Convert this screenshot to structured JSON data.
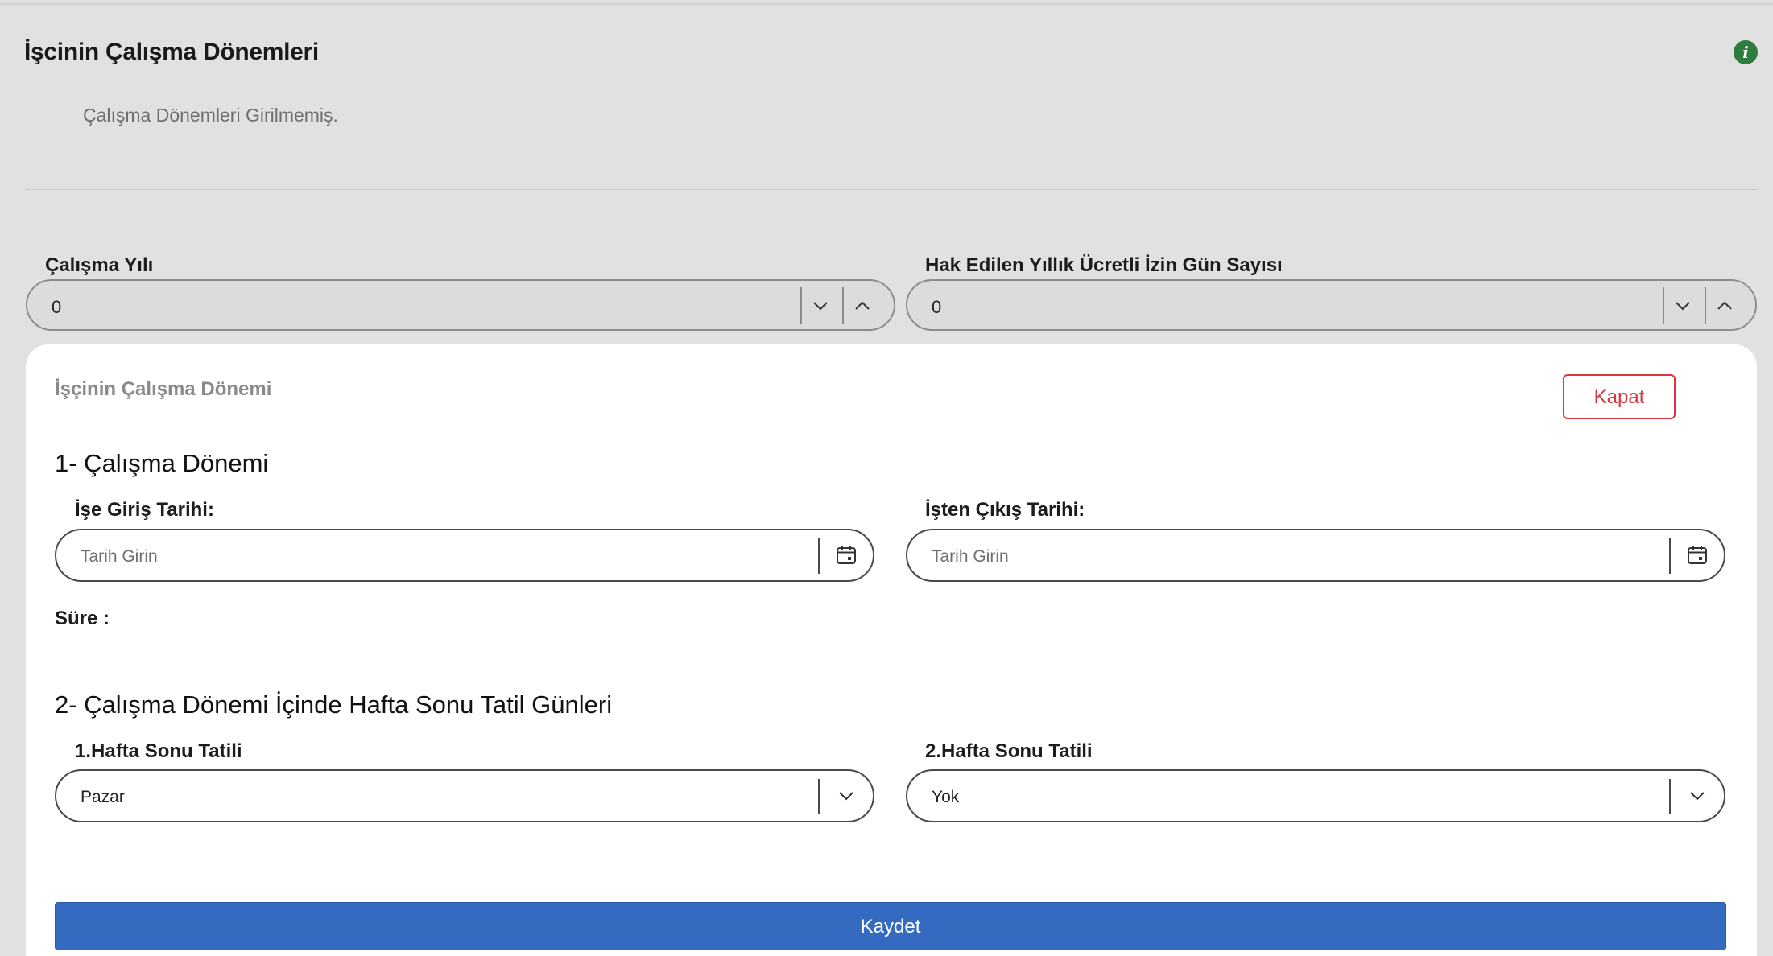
{
  "background_panel": {
    "title": "İşcinin Çalışma Dönemleri",
    "empty_message": "Çalışma Dönemleri Girilmemiş.",
    "info_icon": "info-icon",
    "info_glyph": "i",
    "fields": {
      "work_year": {
        "label": "Çalışma Yılı",
        "value": "0"
      },
      "annual_leave_days": {
        "label": "Hak Edilen Yıllık Ücretli İzin Gün Sayısı",
        "value": "0"
      }
    }
  },
  "modal": {
    "title": "İşçinin Çalışma Dönemi",
    "close_label": "Kapat",
    "section1": {
      "heading": "1- Çalışma Dönemi",
      "start_date": {
        "label": "İşe Giriş Tarihi:",
        "placeholder": "Tarih Girin",
        "icon": "calendar-icon"
      },
      "end_date": {
        "label": "İşten Çıkış Tarihi:",
        "placeholder": "Tarih Girin",
        "icon": "calendar-icon"
      },
      "duration_label": "Süre :"
    },
    "section2": {
      "heading": "2- Çalışma Dönemi İçinde Hafta Sonu Tatil Günleri",
      "weekend1": {
        "label": "1.Hafta Sonu Tatili",
        "value": "Pazar"
      },
      "weekend2": {
        "label": "2.Hafta Sonu Tatili",
        "value": "Yok"
      }
    },
    "save_label": "Kaydet"
  },
  "colors": {
    "overlay_bg": "#e1e1e1",
    "danger": "#d9363e",
    "primary": "#346bc0",
    "info": "#2e7d3e"
  }
}
